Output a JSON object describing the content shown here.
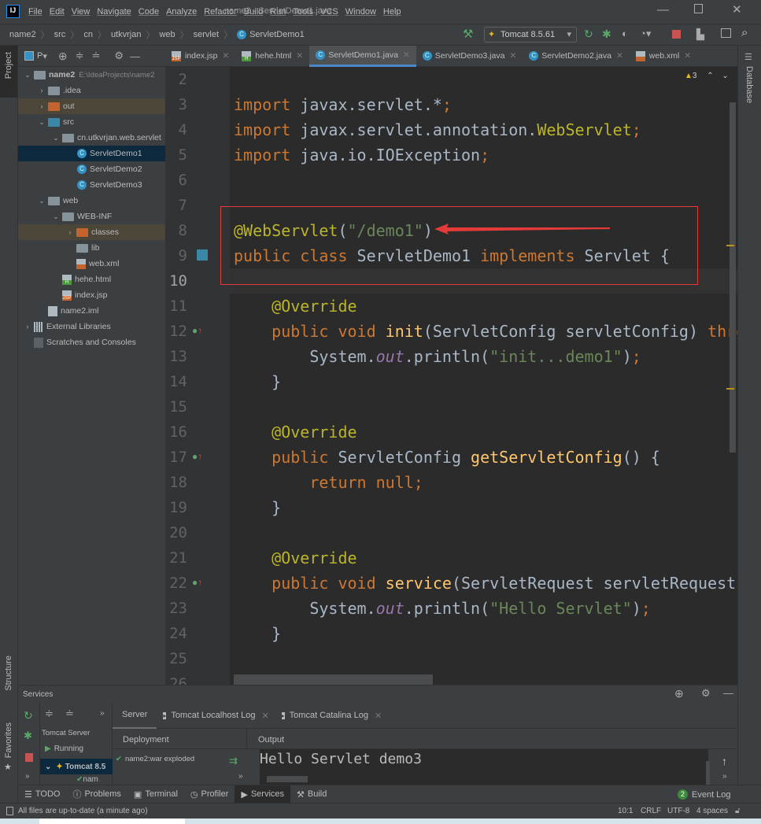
{
  "window": {
    "title": "name2 - ServletDemo1.java",
    "logo": "IJ",
    "controls": [
      "minimize-icon",
      "maximize-icon",
      "close-icon"
    ]
  },
  "menu": [
    "File",
    "Edit",
    "View",
    "Navigate",
    "Code",
    "Analyze",
    "Refactor",
    "Build",
    "Run",
    "Tools",
    "VCS",
    "Window",
    "Help"
  ],
  "breadcrumb": [
    "name2",
    "src",
    "cn",
    "utkvrjan",
    "web",
    "servlet",
    "ServletDemo1"
  ],
  "run_config": "Tomcat 8.5.61",
  "left_stripe": {
    "project": "Project",
    "structure": "Structure",
    "favorites": "Favorites"
  },
  "right_stripe": {
    "database": "Database"
  },
  "project_panel": {
    "header": "P",
    "tree": [
      {
        "label": "name2",
        "hint": "E:\\IdeaProjects\\name2",
        "level": 0,
        "arrow": "down",
        "icon": "module-folder",
        "bold": true
      },
      {
        "label": ".idea",
        "level": 1,
        "arrow": "right",
        "icon": "folder"
      },
      {
        "label": "out",
        "level": 1,
        "arrow": "right",
        "icon": "folder-excluded",
        "excluded": true
      },
      {
        "label": "src",
        "level": 1,
        "arrow": "down",
        "icon": "folder-source"
      },
      {
        "label": "cn.utkvrjan.web.servlet",
        "level": 2,
        "arrow": "down",
        "icon": "package"
      },
      {
        "label": "ServletDemo1",
        "level": 3,
        "icon": "class",
        "selected": true
      },
      {
        "label": "ServletDemo2",
        "level": 3,
        "icon": "class"
      },
      {
        "label": "ServletDemo3",
        "level": 3,
        "icon": "class"
      },
      {
        "label": "web",
        "level": 1,
        "arrow": "down",
        "icon": "folder-web"
      },
      {
        "label": "WEB-INF",
        "level": 2,
        "arrow": "down",
        "icon": "folder"
      },
      {
        "label": "classes",
        "level": 3,
        "arrow": "right",
        "icon": "folder-excluded",
        "excluded": true
      },
      {
        "label": "lib",
        "level": 3,
        "icon": "folder"
      },
      {
        "label": "web.xml",
        "level": 3,
        "icon": "xml-file"
      },
      {
        "label": "hehe.html",
        "level": 2,
        "icon": "html-file"
      },
      {
        "label": "index.jsp",
        "level": 2,
        "icon": "jsp-file"
      },
      {
        "label": "name2.iml",
        "level": 1,
        "icon": "iml-file"
      },
      {
        "label": "External Libraries",
        "level": 0,
        "arrow": "right",
        "icon": "libraries"
      },
      {
        "label": "Scratches and Consoles",
        "level": 0,
        "icon": "scratches"
      }
    ]
  },
  "tabs": [
    {
      "label": "index.jsp",
      "icon": "jsp-file"
    },
    {
      "label": "hehe.html",
      "icon": "html-file"
    },
    {
      "label": "ServletDemo1.java",
      "icon": "class",
      "active": true
    },
    {
      "label": "ServletDemo3.java",
      "icon": "class"
    },
    {
      "label": "ServletDemo2.java",
      "icon": "class"
    },
    {
      "label": "web.xml",
      "icon": "xml-file"
    }
  ],
  "editor": {
    "warnings": "3",
    "current_line": 10,
    "lines": [
      {
        "n": 2,
        "t": []
      },
      {
        "n": 3,
        "t": [
          [
            "import",
            "kw"
          ],
          [
            " javax.servlet.*",
            ""
          ],
          [
            ";",
            "kw"
          ]
        ]
      },
      {
        "n": 4,
        "t": [
          [
            "import",
            "kw"
          ],
          [
            " javax.servlet.annotation.",
            ""
          ],
          [
            "WebServlet",
            "ann"
          ],
          [
            ";",
            "kw"
          ]
        ]
      },
      {
        "n": 5,
        "t": [
          [
            "import",
            "kw"
          ],
          [
            " java.io.IOException",
            ""
          ],
          [
            ";",
            "kw"
          ]
        ]
      },
      {
        "n": 6,
        "t": []
      },
      {
        "n": 7,
        "t": []
      },
      {
        "n": 8,
        "t": [
          [
            "@WebServlet",
            "ann"
          ],
          [
            "(",
            ""
          ],
          [
            "\"/demo1\"",
            "str"
          ],
          [
            ")",
            ""
          ]
        ]
      },
      {
        "n": 9,
        "t": [
          [
            "public class ",
            "kw"
          ],
          [
            "ServletDemo1 ",
            ""
          ],
          [
            "implements ",
            "kw"
          ],
          [
            "Servlet {",
            ""
          ]
        ]
      },
      {
        "n": 10,
        "t": []
      },
      {
        "n": 11,
        "t": [
          [
            "    ",
            ""
          ],
          [
            "@Override",
            "ann"
          ]
        ]
      },
      {
        "n": 12,
        "t": [
          [
            "    public void ",
            "kw"
          ],
          [
            "init",
            "fn"
          ],
          [
            "(ServletConfig servletConfig) ",
            ""
          ],
          [
            "thro",
            "kw"
          ]
        ]
      },
      {
        "n": 13,
        "t": [
          [
            "        System.",
            ""
          ],
          [
            "out",
            "st"
          ],
          [
            ".println(",
            ""
          ],
          [
            "\"init...demo1\"",
            "str"
          ],
          [
            ")",
            ""
          ],
          [
            ";",
            "kw"
          ]
        ]
      },
      {
        "n": 14,
        "t": [
          [
            "    }",
            ""
          ]
        ]
      },
      {
        "n": 15,
        "t": []
      },
      {
        "n": 16,
        "t": [
          [
            "    ",
            ""
          ],
          [
            "@Override",
            "ann"
          ]
        ]
      },
      {
        "n": 17,
        "t": [
          [
            "    public ",
            "kw"
          ],
          [
            "ServletConfig ",
            ""
          ],
          [
            "getServletConfig",
            "fn"
          ],
          [
            "() {",
            ""
          ]
        ]
      },
      {
        "n": 18,
        "t": [
          [
            "        return null",
            "kw"
          ],
          [
            ";",
            "kw"
          ]
        ]
      },
      {
        "n": 19,
        "t": [
          [
            "    }",
            ""
          ]
        ]
      },
      {
        "n": 20,
        "t": []
      },
      {
        "n": 21,
        "t": [
          [
            "    ",
            ""
          ],
          [
            "@Override",
            "ann"
          ]
        ]
      },
      {
        "n": 22,
        "t": [
          [
            "    public void ",
            "kw"
          ],
          [
            "service",
            "fn"
          ],
          [
            "(ServletRequest servletRequest,",
            ""
          ]
        ]
      },
      {
        "n": 23,
        "t": [
          [
            "        System.",
            ""
          ],
          [
            "out",
            "st"
          ],
          [
            ".println(",
            ""
          ],
          [
            "\"Hello Servlet\"",
            "str"
          ],
          [
            ")",
            ""
          ],
          [
            ";",
            "kw"
          ]
        ]
      },
      {
        "n": 24,
        "t": [
          [
            "    }",
            ""
          ]
        ]
      },
      {
        "n": 25,
        "t": []
      },
      {
        "n": 26,
        "t": [
          [
            "    ",
            ""
          ],
          [
            "@Override",
            "ann"
          ]
        ]
      }
    ]
  },
  "services": {
    "title": "Services",
    "tree": {
      "group": "Tomcat Server",
      "status": "Running",
      "server": "Tomcat 8.5",
      "artifact": "nam"
    },
    "tabs": [
      "Server",
      "Tomcat Localhost Log",
      "Tomcat Catalina Log"
    ],
    "deployment_header": "Deployment",
    "deployment_item": "name2:war exploded",
    "output_header": "Output",
    "output_text": "Hello Servlet demo3"
  },
  "tool_windows": [
    "TODO",
    "Problems",
    "Terminal",
    "Profiler",
    "Services",
    "Build"
  ],
  "event_log": {
    "count": "2",
    "label": "Event Log"
  },
  "status_bar": {
    "message": "All files are up-to-date (a minute ago)",
    "position": "10:1",
    "line_sep": "CRLF",
    "encoding": "UTF-8",
    "indent": "4 spaces"
  },
  "colors": {
    "accent": "#4a88c7",
    "highlight_box": "#e43a3a",
    "keyword": "#cc7832",
    "annotation": "#bbb529",
    "string": "#6a8759"
  }
}
